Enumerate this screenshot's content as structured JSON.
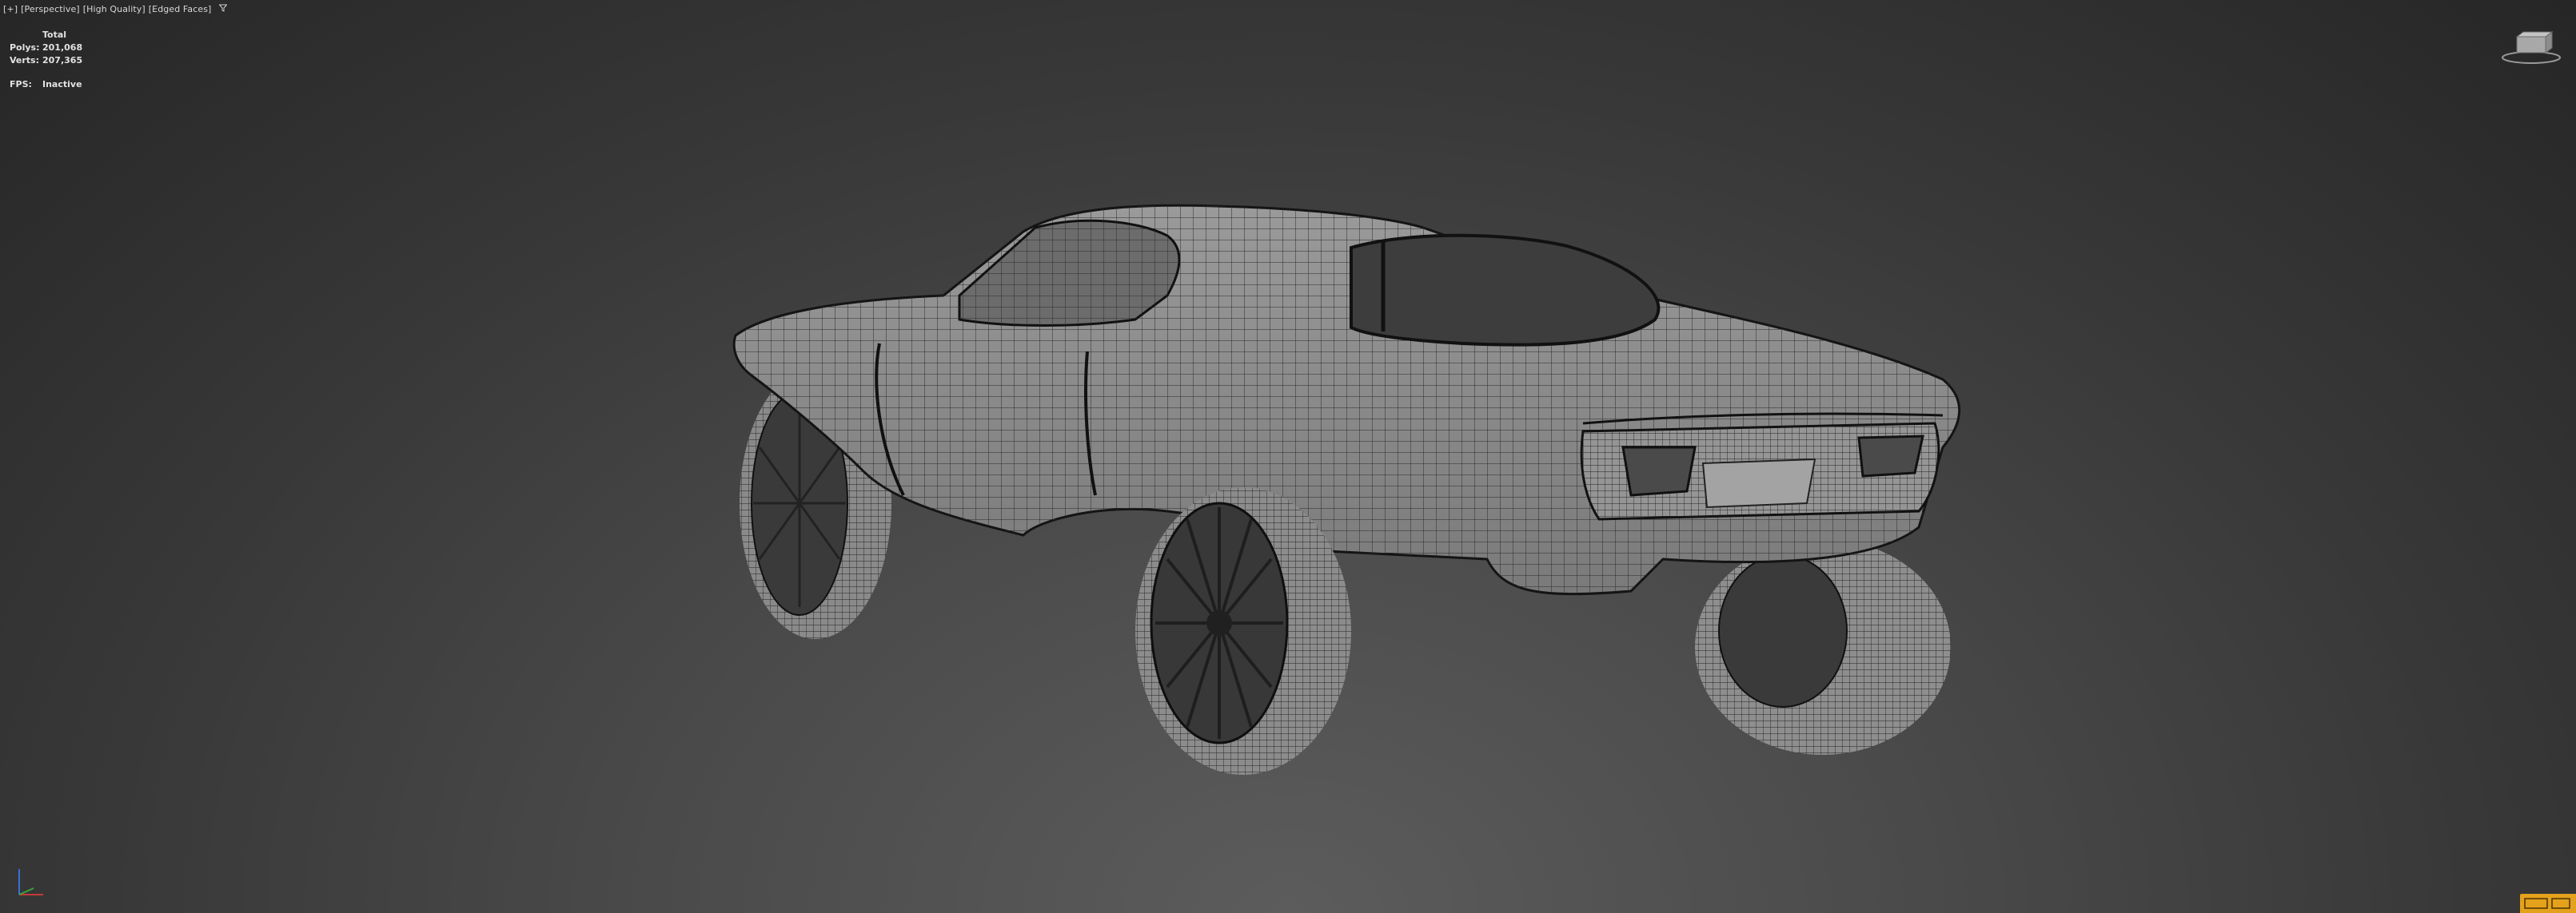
{
  "viewport": {
    "labels": [
      "[+]",
      "[Perspective]",
      "[High Quality]",
      "[Edged Faces]"
    ],
    "filter_icon": "filter-icon"
  },
  "stats": {
    "header": "Total",
    "polys_label": "Polys:",
    "polys_value": "201,068",
    "verts_label": "Verts:",
    "verts_value": "207,365",
    "fps_label": "FPS:",
    "fps_value": "Inactive"
  },
  "colors": {
    "background_top": "#262626",
    "background_bottom": "#5c5c5c",
    "mesh_fill": "#8a8a8a",
    "wireframe": "#1a1a1a",
    "text": "#e2e2e2",
    "gizmo_accent": "#e4a11b"
  },
  "icons": {
    "viewcube": "viewcube-icon",
    "axis_tripod": "axis-tripod-icon",
    "navigation": "navigation-gizmo-icon"
  }
}
